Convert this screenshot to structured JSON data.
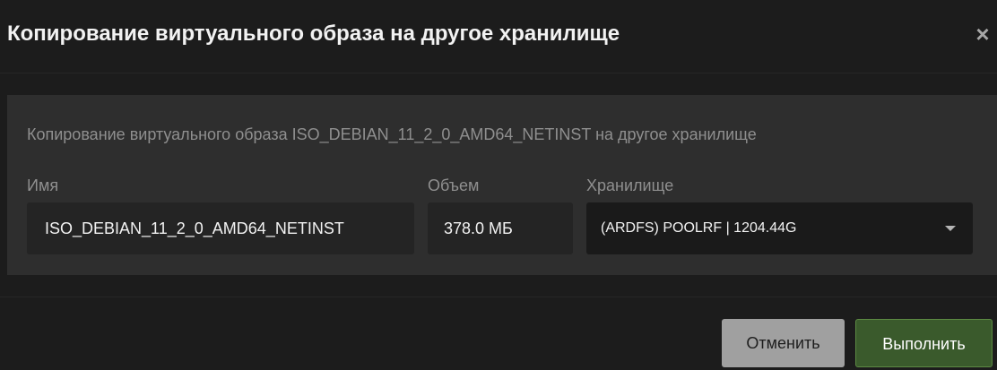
{
  "dialog": {
    "title": "Копирование виртуального образа на другое хранилище",
    "close_icon": "×",
    "description": "Копирование виртуального образа ISO_DEBIAN_11_2_0_AMD64_NETINST на другое хранилище",
    "fields": {
      "name": {
        "label": "Имя",
        "value": "ISO_DEBIAN_11_2_0_AMD64_NETINST"
      },
      "size": {
        "label": "Объем",
        "value": "378.0 МБ"
      },
      "storage": {
        "label": "Хранилище",
        "selected": "(ARDFS) POOLRF | 1204.44G"
      }
    },
    "buttons": {
      "cancel": "Отменить",
      "submit": "Выполнить"
    },
    "colors": {
      "background": "#1c1c1c",
      "panel": "#2e2e2e",
      "submit": "#3a5a2c",
      "cancel": "#a0a0a0"
    }
  }
}
